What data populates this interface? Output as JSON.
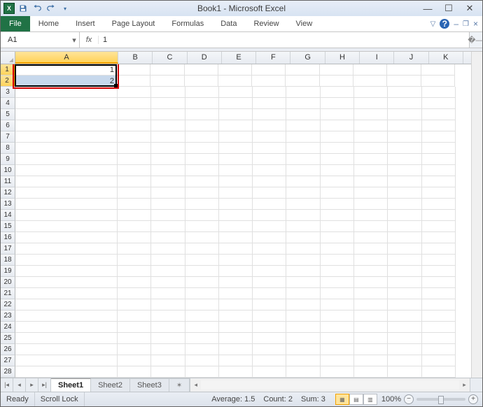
{
  "window": {
    "title": "Book1 - Microsoft Excel"
  },
  "qat": {
    "save": "save-icon",
    "undo": "undo-icon",
    "redo": "redo-icon"
  },
  "tabs": {
    "file": "File",
    "items": [
      "Home",
      "Insert",
      "Page Layout",
      "Formulas",
      "Data",
      "Review",
      "View"
    ]
  },
  "namebox": {
    "value": "A1"
  },
  "formula_bar": {
    "label": "fx",
    "value": "1"
  },
  "columns": [
    "A",
    "B",
    "C",
    "D",
    "E",
    "F",
    "G",
    "H",
    "I",
    "J",
    "K"
  ],
  "row_count": 30,
  "cells": {
    "A1": "1",
    "A2": "2"
  },
  "selection": {
    "range": "A1:A2",
    "active": "A1"
  },
  "sheets": {
    "active": "Sheet1",
    "items": [
      "Sheet1",
      "Sheet2",
      "Sheet3"
    ]
  },
  "status": {
    "mode": "Ready",
    "scroll_lock": "Scroll Lock",
    "aggregates": {
      "avg_label": "Average:",
      "avg": "1.5",
      "count_label": "Count:",
      "count": "2",
      "sum_label": "Sum:",
      "sum": "3"
    },
    "zoom": "100%"
  }
}
